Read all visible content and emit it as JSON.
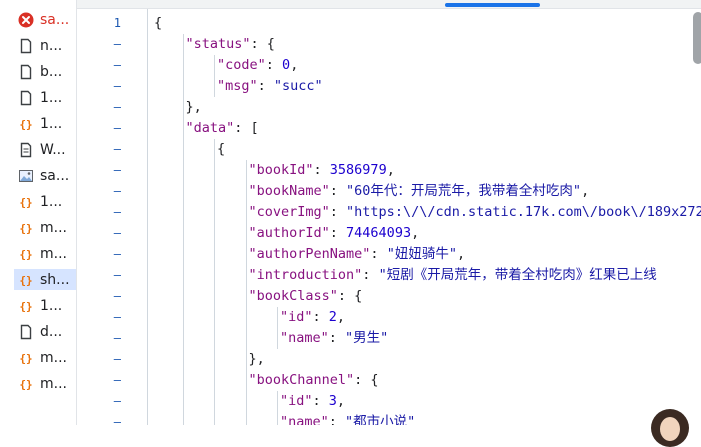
{
  "sidebar": {
    "items": [
      {
        "label": "sa...",
        "icon": "error-icon",
        "state": "error"
      },
      {
        "label": "n...",
        "icon": "document-icon"
      },
      {
        "label": "b...",
        "icon": "document-icon"
      },
      {
        "label": "1...",
        "icon": "document-icon"
      },
      {
        "label": "1...",
        "icon": "json-icon"
      },
      {
        "label": "W...",
        "icon": "websocket-icon"
      },
      {
        "label": "sa...",
        "icon": "image-icon"
      },
      {
        "label": "1...",
        "icon": "json-icon"
      },
      {
        "label": "m...",
        "icon": "json-icon"
      },
      {
        "label": "m...",
        "icon": "json-icon"
      },
      {
        "label": "sh...",
        "icon": "json-icon",
        "state": "selected"
      },
      {
        "label": "1...",
        "icon": "json-icon"
      },
      {
        "label": "d...",
        "icon": "document-icon"
      },
      {
        "label": "m...",
        "icon": "json-icon"
      },
      {
        "label": "m...",
        "icon": "json-icon"
      }
    ]
  },
  "editor": {
    "line_numbers": [
      "1",
      "–",
      "–",
      "–",
      "–",
      "–",
      "–",
      "–",
      "–",
      "–",
      "–",
      "–",
      "–",
      "–",
      "–",
      "–",
      "–",
      "–",
      "–",
      "–"
    ],
    "lines": [
      {
        "indent": 0,
        "parts": [
          {
            "t": "{",
            "c": "p"
          }
        ]
      },
      {
        "indent": 1,
        "parts": [
          {
            "t": "\"status\"",
            "c": "k"
          },
          {
            "t": ": {",
            "c": "p"
          }
        ]
      },
      {
        "indent": 2,
        "parts": [
          {
            "t": "\"code\"",
            "c": "k"
          },
          {
            "t": ": ",
            "c": "p"
          },
          {
            "t": "0",
            "c": "n"
          },
          {
            "t": ",",
            "c": "p"
          }
        ]
      },
      {
        "indent": 2,
        "parts": [
          {
            "t": "\"msg\"",
            "c": "k"
          },
          {
            "t": ": ",
            "c": "p"
          },
          {
            "t": "\"succ\"",
            "c": "s"
          }
        ]
      },
      {
        "indent": 1,
        "parts": [
          {
            "t": "},",
            "c": "p"
          }
        ]
      },
      {
        "indent": 1,
        "parts": [
          {
            "t": "\"data\"",
            "c": "k"
          },
          {
            "t": ": [",
            "c": "p"
          }
        ]
      },
      {
        "indent": 2,
        "parts": [
          {
            "t": "{",
            "c": "p"
          }
        ]
      },
      {
        "indent": 3,
        "parts": [
          {
            "t": "\"bookId\"",
            "c": "k"
          },
          {
            "t": ": ",
            "c": "p"
          },
          {
            "t": "3586979",
            "c": "n"
          },
          {
            "t": ",",
            "c": "p"
          }
        ]
      },
      {
        "indent": 3,
        "parts": [
          {
            "t": "\"bookName\"",
            "c": "k"
          },
          {
            "t": ": ",
            "c": "p"
          },
          {
            "t": "\"60年代：开局荒年，我带着全村吃肉\"",
            "c": "s"
          },
          {
            "t": ",",
            "c": "p"
          }
        ]
      },
      {
        "indent": 3,
        "parts": [
          {
            "t": "\"coverImg\"",
            "c": "k"
          },
          {
            "t": ": ",
            "c": "p"
          },
          {
            "t": "\"https:\\/\\/cdn.static.17k.com\\/book\\/189x272",
            "c": "s"
          }
        ]
      },
      {
        "indent": 3,
        "parts": [
          {
            "t": "\"authorId\"",
            "c": "k"
          },
          {
            "t": ": ",
            "c": "p"
          },
          {
            "t": "74464093",
            "c": "n"
          },
          {
            "t": ",",
            "c": "p"
          }
        ]
      },
      {
        "indent": 3,
        "parts": [
          {
            "t": "\"authorPenName\"",
            "c": "k"
          },
          {
            "t": ": ",
            "c": "p"
          },
          {
            "t": "\"妞妞骑牛\"",
            "c": "s"
          },
          {
            "t": ",",
            "c": "p"
          }
        ]
      },
      {
        "indent": 3,
        "parts": [
          {
            "t": "\"introduction\"",
            "c": "k"
          },
          {
            "t": ": ",
            "c": "p"
          },
          {
            "t": "\"短剧《开局荒年，带着全村吃肉》红果已上线",
            "c": "s"
          }
        ]
      },
      {
        "indent": 3,
        "parts": [
          {
            "t": "\"bookClass\"",
            "c": "k"
          },
          {
            "t": ": {",
            "c": "p"
          }
        ]
      },
      {
        "indent": 4,
        "parts": [
          {
            "t": "\"id\"",
            "c": "k"
          },
          {
            "t": ": ",
            "c": "p"
          },
          {
            "t": "2",
            "c": "n"
          },
          {
            "t": ",",
            "c": "p"
          }
        ]
      },
      {
        "indent": 4,
        "parts": [
          {
            "t": "\"name\"",
            "c": "k"
          },
          {
            "t": ": ",
            "c": "p"
          },
          {
            "t": "\"男生\"",
            "c": "s"
          }
        ]
      },
      {
        "indent": 3,
        "parts": [
          {
            "t": "},",
            "c": "p"
          }
        ]
      },
      {
        "indent": 3,
        "parts": [
          {
            "t": "\"bookChannel\"",
            "c": "k"
          },
          {
            "t": ": {",
            "c": "p"
          }
        ]
      },
      {
        "indent": 4,
        "parts": [
          {
            "t": "\"id\"",
            "c": "k"
          },
          {
            "t": ": ",
            "c": "p"
          },
          {
            "t": "3",
            "c": "n"
          },
          {
            "t": ",",
            "c": "p"
          }
        ]
      },
      {
        "indent": 4,
        "parts": [
          {
            "t": "\"name\"",
            "c": "k"
          },
          {
            "t": ": ",
            "c": "p"
          },
          {
            "t": "\"都市小说\"",
            "c": "s"
          }
        ]
      }
    ]
  },
  "colors": {
    "key": "#881280",
    "string": "#1a1aa6",
    "number": "#1c00cf",
    "selected_row": "#d6e4ff",
    "accent": "#1a73e8",
    "error": "#d93025"
  }
}
